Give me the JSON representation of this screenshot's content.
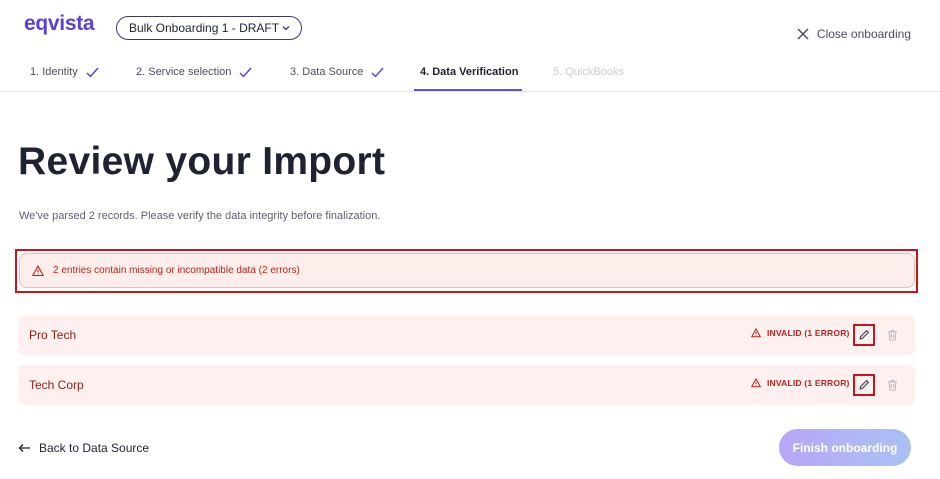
{
  "header": {
    "logo_text": "eqvista",
    "project_select": "Bulk Onboarding 1 - DRAFT",
    "close_label": "Close onboarding"
  },
  "steps": [
    {
      "label": "1. Identity",
      "state": "done"
    },
    {
      "label": "2. Service selection",
      "state": "done"
    },
    {
      "label": "3. Data Source",
      "state": "done"
    },
    {
      "label": "4. Data Verification",
      "state": "active"
    },
    {
      "label": "5. QuickBooks",
      "state": "disabled"
    }
  ],
  "main": {
    "title": "Review your Import",
    "subtitle": "We've parsed 2 records. Please verify the data integrity before finalization.",
    "alert": "2 entries contain missing or incompatible data (2 errors)"
  },
  "records": [
    {
      "name": "Pro Tech",
      "status": "INVALID (1 ERROR)"
    },
    {
      "name": "Tech Corp",
      "status": "INVALID (1 ERROR)"
    }
  ],
  "footer": {
    "back_label": "Back to Data Source",
    "finish_label": "Finish onboarding"
  },
  "colors": {
    "brand": "#5b3fd6",
    "error": "#b3261e",
    "error_bg": "#fdeeec"
  }
}
